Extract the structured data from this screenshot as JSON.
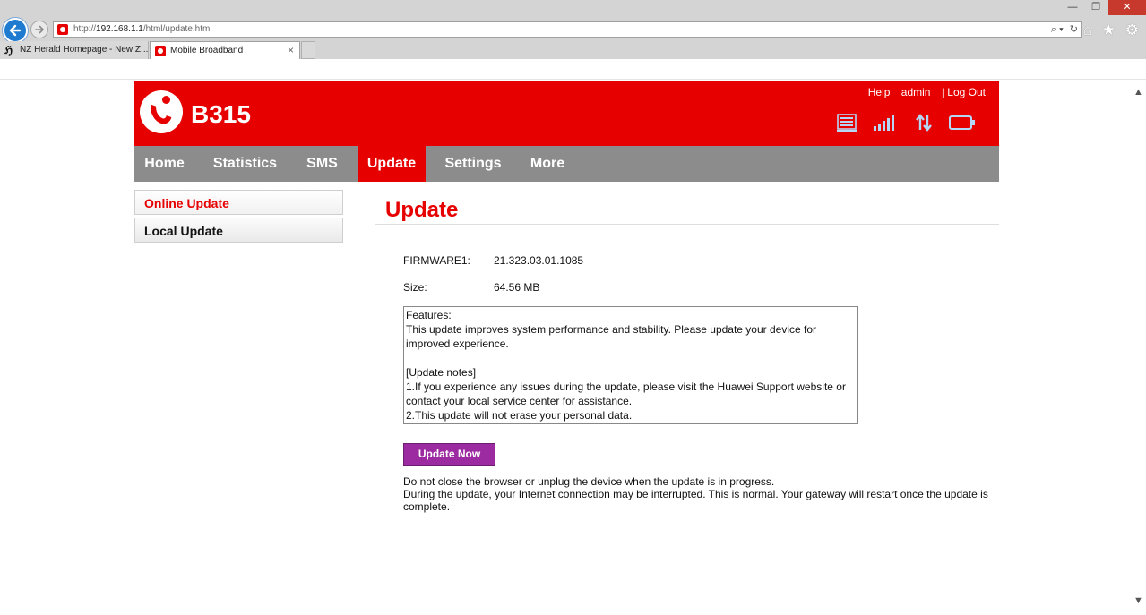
{
  "browser": {
    "address_prefix": "http://",
    "address_host": "192.168.1.1",
    "address_path": "/html/update.html",
    "address_tools": [
      "⌕ ▾",
      "↻"
    ],
    "window_buttons": {
      "minimize": "—",
      "maximize": "❐",
      "close": "✕"
    },
    "icons": {
      "home": "⌂",
      "favorites": "★",
      "settings": "⚙"
    },
    "tabs": [
      {
        "label": "NZ Herald Homepage - New Z...",
        "icon": "newspaper-icon",
        "glyph": "ℌ"
      },
      {
        "label": "Mobile Broadband",
        "icon": "vodafone-favicon",
        "close": "×"
      }
    ]
  },
  "header": {
    "logo_text": "B315",
    "links": {
      "help": "Help",
      "admin": "admin",
      "separator": "|",
      "logout": "Log Out"
    },
    "status_icons": [
      "wifi-list-icon",
      "signal-strength-icon",
      "data-transfer-icon",
      "battery-icon"
    ],
    "accent_color": "#e60000"
  },
  "menu": [
    {
      "label": "Home"
    },
    {
      "label": "Statistics"
    },
    {
      "label": "SMS"
    },
    {
      "label": "Update",
      "active": true
    },
    {
      "label": "Settings"
    },
    {
      "label": "More"
    }
  ],
  "sidebar": [
    {
      "label": "Online Update",
      "active": true
    },
    {
      "label": "Local Update"
    }
  ],
  "content": {
    "title": "Update",
    "firmware_label": "FIRMWARE1:",
    "firmware_value": "21.323.03.01.1085",
    "size_label": "Size:",
    "size_value": "64.56 MB",
    "notes": {
      "features_heading": "Features:",
      "features_text": "This update improves system performance and stability. Please update your device for improved experience.",
      "notes_heading": "[Update notes]",
      "note1": "1.If you experience any issues during the update, please visit the Huawei Support website or contact your local service center for assistance.",
      "note2": "2.This update will not erase your personal data."
    },
    "button_label": "Update Now",
    "button_color": "#9c2aa0",
    "warning_line1": "Do not close the browser or unplug the device when the update is in progress.",
    "warning_line2": "During the update, your Internet connection may be interrupted. This is normal. Your gateway will restart once the update is complete."
  },
  "scrollbar": {
    "up": "▲",
    "down": "▼"
  }
}
